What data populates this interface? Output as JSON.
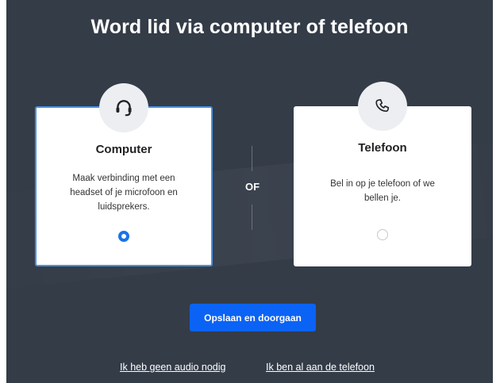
{
  "title": "Word lid via computer of telefoon",
  "options": {
    "computer": {
      "title": "Computer",
      "description": "Maak verbinding met een headset of je microfoon en luidsprekers.",
      "icon": "headset-icon",
      "selected": true
    },
    "phone": {
      "title": "Telefoon",
      "description": "Bel in op je telefoon of we bellen je.",
      "icon": "phone-icon",
      "selected": false
    }
  },
  "separator_label": "OF",
  "primary_button": "Opslaan en doorgaan",
  "links": {
    "no_audio": "Ik heb geen audio nodig",
    "already_on_phone": "Ik ben al aan de telefoon"
  },
  "colors": {
    "background": "#343c48",
    "primary": "#0b63f5",
    "selected_border": "#4a90e2",
    "card": "#ffffff"
  }
}
